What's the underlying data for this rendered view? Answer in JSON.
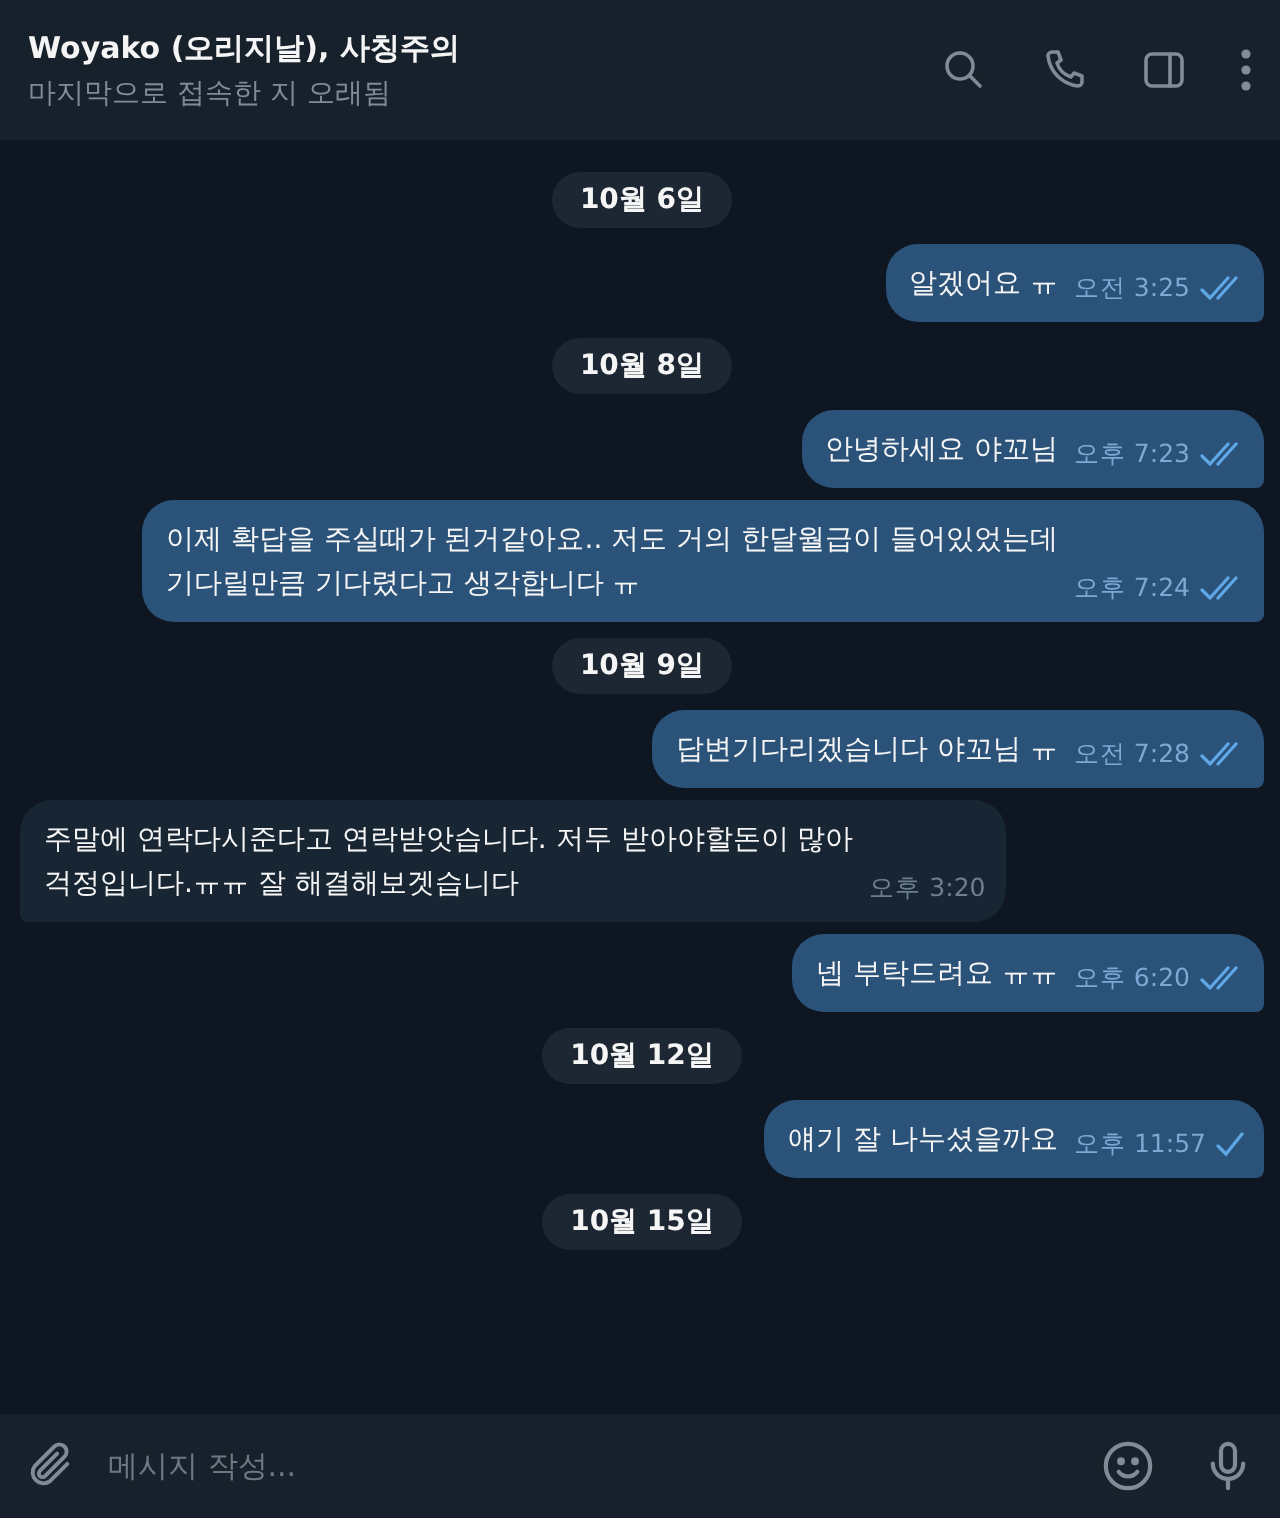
{
  "header": {
    "title": "Woyako (오리지날), 사칭주의",
    "status": "마지막으로 접속한 지 오래됨"
  },
  "items": [
    {
      "kind": "date",
      "text": "10월 6일"
    },
    {
      "kind": "message",
      "outgoing": true,
      "lines": [
        "알겠어요 ㅠ"
      ],
      "time": "오전 3:25",
      "read": true
    },
    {
      "kind": "date",
      "text": "10월 8일"
    },
    {
      "kind": "message",
      "outgoing": true,
      "lines": [
        "안녕하세요 야꼬님"
      ],
      "time": "오후 7:23",
      "read": true
    },
    {
      "kind": "message",
      "outgoing": true,
      "lines": [
        "이제 확답을 주실때가 된거같아요.. 저도 거의 한달월급이 들어있었는데",
        "기다릴만큼 기다렸다고 생각합니다 ㅠ"
      ],
      "time": "오후 7:24",
      "read": true
    },
    {
      "kind": "date",
      "text": "10월 9일"
    },
    {
      "kind": "message",
      "outgoing": true,
      "lines": [
        "답변기다리겠습니다 야꼬님 ㅠ"
      ],
      "time": "오전 7:28",
      "read": true
    },
    {
      "kind": "message",
      "outgoing": false,
      "lines": [
        "주말에 연락다시준다고 연락받앗습니다. 저두 받아야할돈이 많아",
        "걱정입니다.ㅠㅠ 잘 해결해보겟습니다"
      ],
      "time": "오후 3:20"
    },
    {
      "kind": "message",
      "outgoing": true,
      "lines": [
        "넵 부탁드려요 ㅠㅠ"
      ],
      "time": "오후 6:20",
      "read": true
    },
    {
      "kind": "date",
      "text": "10월 12일"
    },
    {
      "kind": "message",
      "outgoing": true,
      "lines": [
        "얘기 잘 나누셨을까요"
      ],
      "time": "오후 11:57",
      "read": false
    },
    {
      "kind": "date",
      "text": "10월 15일"
    }
  ],
  "composer": {
    "placeholder": "메시지 작성..."
  }
}
